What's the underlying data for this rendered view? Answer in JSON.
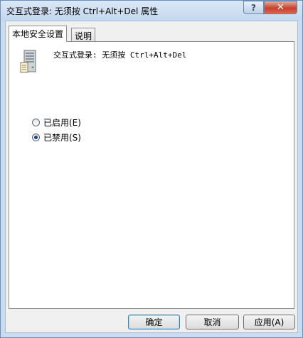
{
  "window": {
    "title": "交互式登录: 无须按 Ctrl+Alt+Del 属性",
    "help_label": "?",
    "close_label": "✕"
  },
  "tabs": [
    {
      "label": "本地安全设置",
      "active": true
    },
    {
      "label": "说明",
      "active": false
    }
  ],
  "policy": {
    "icon": "server-computer-icon",
    "name": "交互式登录: 无须按 Ctrl+Alt+Del"
  },
  "options": [
    {
      "label": "已启用(E)",
      "checked": false
    },
    {
      "label": "已禁用(S)",
      "checked": true
    }
  ],
  "buttons": {
    "ok": "确定",
    "cancel": "取消",
    "apply": "应用(A)"
  }
}
